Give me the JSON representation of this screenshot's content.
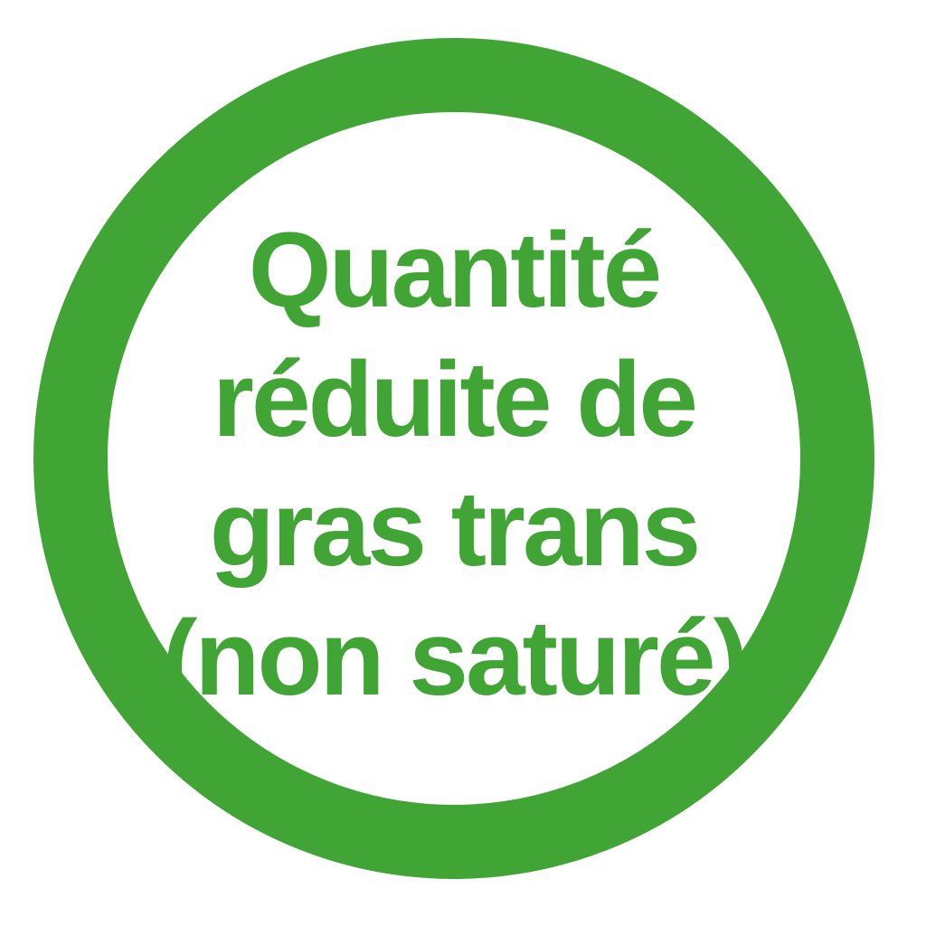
{
  "badge": {
    "color": "#41a535",
    "lines": [
      "Quantité",
      "réduite de",
      "gras trans",
      "(non saturé)"
    ]
  }
}
